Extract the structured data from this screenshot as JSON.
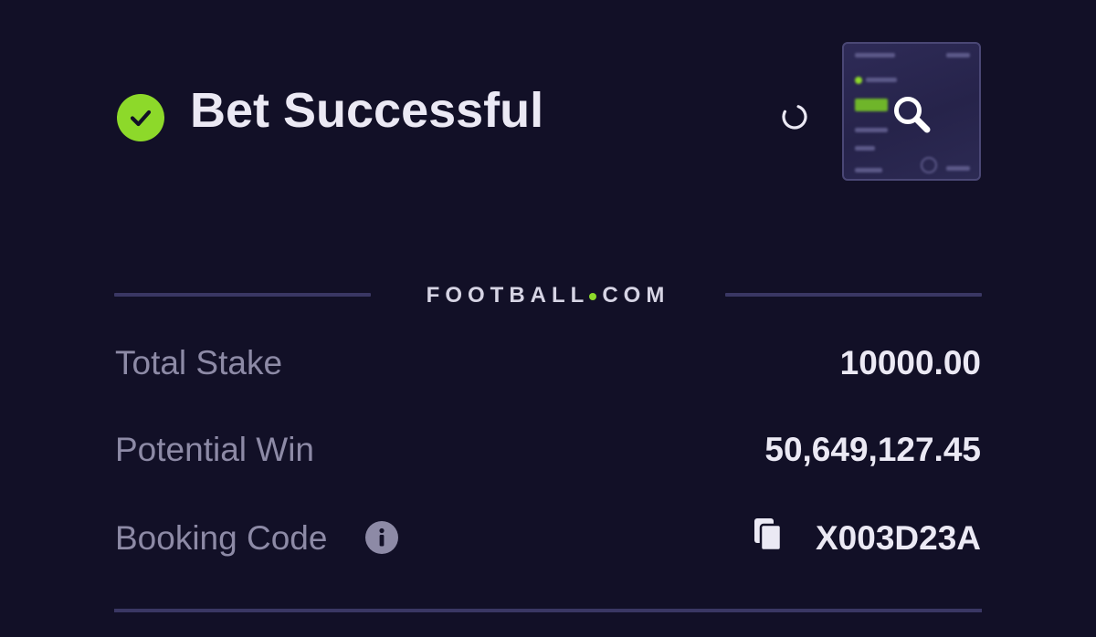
{
  "header": {
    "title": "Bet Successful",
    "status_icon": "check-circle-icon",
    "status_color": "#8dd92a",
    "loading_icon": "spinner-icon",
    "thumbnail_action_icon": "zoom-icon"
  },
  "brand": {
    "name_left": "FOOTBALL",
    "name_right": "COM",
    "dot_color": "#8dd92a"
  },
  "summary": {
    "rows": [
      {
        "label": "Total Stake",
        "value": "10000.00"
      },
      {
        "label": "Potential Win",
        "value": "50,649,127.45"
      },
      {
        "label": "Booking Code",
        "value": "X003D23A",
        "label_icon": "info-icon",
        "value_icon": "copy-icon"
      }
    ]
  },
  "colors": {
    "background": "#121027",
    "divider": "#3a3764",
    "label_text": "#8d8aa6",
    "value_text": "#ebe9f4"
  }
}
